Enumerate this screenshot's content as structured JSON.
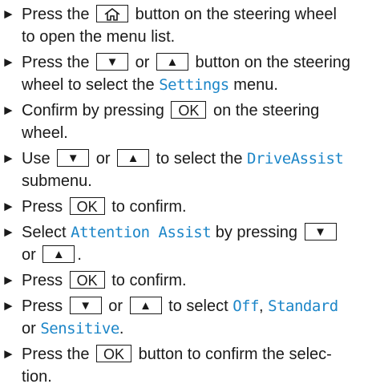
{
  "bullet": "►",
  "keys": {
    "down": "▼",
    "up": "▲",
    "ok": "OK"
  },
  "colors": {
    "menu_text": "#1c86c8",
    "body_text": "#1a1a1a"
  },
  "steps": [
    {
      "a": "Press the",
      "b": "button on the steering wheel",
      "c": "to open the menu list."
    },
    {
      "a": "Press the",
      "b": "or",
      "c": "button on the steering",
      "d": "wheel to select the",
      "menu": "Settings",
      "e": "menu."
    },
    {
      "a": "Confirm by pressing",
      "b": "on the steering",
      "c": "wheel."
    },
    {
      "a": "Use",
      "b": "or",
      "c": "to select the",
      "menu": "DriveAssist",
      "d": "submenu."
    },
    {
      "a": "Press",
      "b": "to confirm."
    },
    {
      "a": "Select",
      "menu": "Attention Assist",
      "b": "by pressing",
      "c": "or",
      "d": "."
    },
    {
      "a": "Press",
      "b": "to confirm."
    },
    {
      "a": "Press",
      "b": "or",
      "c": "to select",
      "menu1": "Off",
      "sep": ",",
      "menu2": "Standard",
      "d": "or",
      "menu3": "Sensitive",
      "e": "."
    },
    {
      "a": "Press the",
      "b": "button to confirm the selec-",
      "c": "tion."
    }
  ]
}
